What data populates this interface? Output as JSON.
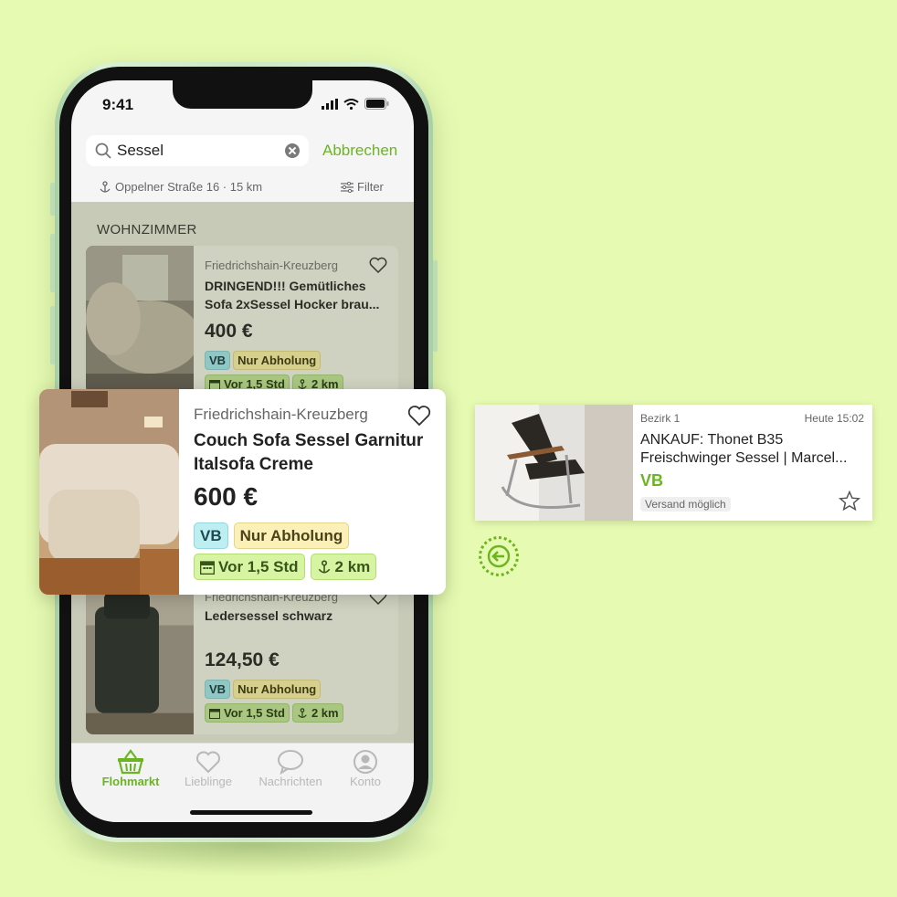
{
  "status_bar": {
    "time": "9:41"
  },
  "search": {
    "query": "Sessel",
    "cancel_label": "Abbrechen"
  },
  "location": {
    "text": "Oppelner Straße 16 · 15 km",
    "filter_label": "Filter"
  },
  "section": {
    "title": "WOHNZIMMER"
  },
  "listings": [
    {
      "district": "Friedrichshain-Kreuzberg",
      "title": "DRINGEND!!! Gemütliches Sofa 2xSessel Hocker brau...",
      "price": "400 €",
      "tag_vb": "VB",
      "tag_pickup": "Nur Abholung",
      "age": "Vor 1,5 Std",
      "distance": "2 km"
    },
    {
      "district": "Friedrichshain-Kreuzberg",
      "title": "Ledersessel schwarz",
      "price": "124,50 €",
      "tag_vb": "VB",
      "tag_pickup": "Nur Abholung",
      "age": "Vor 1,5 Std",
      "distance": "2 km"
    }
  ],
  "featured": {
    "district": "Friedrichshain-Kreuzberg",
    "title": "Couch Sofa Sessel Garnitur Italsofa Creme",
    "price": "600 €",
    "tag_vb": "VB",
    "tag_pickup": "Nur Abholung",
    "age": "Vor 1,5 Std",
    "distance": "2 km"
  },
  "side_card": {
    "district": "Bezirk 1",
    "time": "Heute 15:02",
    "title": "ANKAUF: Thonet B35 Freischwinger Sessel | Marcel...",
    "price": "VB",
    "shipping": "Versand möglich"
  },
  "tabs": [
    {
      "label": "Flohmarkt",
      "icon": "basket-icon",
      "active": true
    },
    {
      "label": "Lieblinge",
      "icon": "heart-icon"
    },
    {
      "label": "Nachrichten",
      "icon": "chat-bubble-icon"
    },
    {
      "label": "Konto",
      "icon": "user-icon"
    }
  ],
  "colors": {
    "background": "#e6fab2",
    "accent": "#6bb520"
  }
}
